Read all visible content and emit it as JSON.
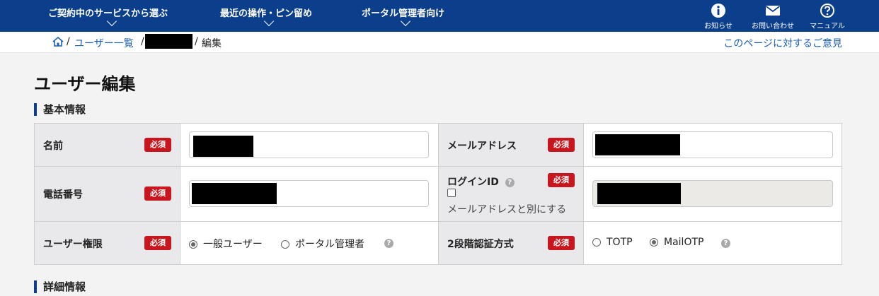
{
  "nav": {
    "items": [
      {
        "label": "ご契約中のサービスから選ぶ"
      },
      {
        "label": "最近の操作・ピン留め"
      },
      {
        "label": "ポータル管理者向け"
      }
    ],
    "utilities": [
      {
        "label": "お知らせ",
        "icon": "info-icon"
      },
      {
        "label": "お問い合わせ",
        "icon": "mail-icon"
      },
      {
        "label": "マニュアル",
        "icon": "help-circle-icon"
      }
    ]
  },
  "breadcrumb": {
    "home_icon": "home-icon",
    "sep": "/",
    "users_list": "ユーザー一覧",
    "current": "編集",
    "feedback": "このページに対するご意見"
  },
  "page": {
    "title": "ユーザー編集",
    "section_basic": "基本情報",
    "section_detail": "詳細情報"
  },
  "form": {
    "required": "必須",
    "name_label": "名前",
    "email_label": "メールアドレス",
    "phone_label": "電話番号",
    "login_label": "ログインID",
    "login_separate": "メールアドレスと別にする",
    "role_label": "ユーザー権限",
    "role_options": [
      "一般ユーザー",
      "ポータル管理者"
    ],
    "role_selected": "一般ユーザー",
    "mfa_label": "2段階認証方式",
    "mfa_options": [
      "TOTP",
      "MailOTP"
    ],
    "mfa_selected": "MailOTP"
  },
  "colors": {
    "nav_bg": "#0b3f8c",
    "required_badge": "#c7161d",
    "link": "#1a5fb4"
  }
}
